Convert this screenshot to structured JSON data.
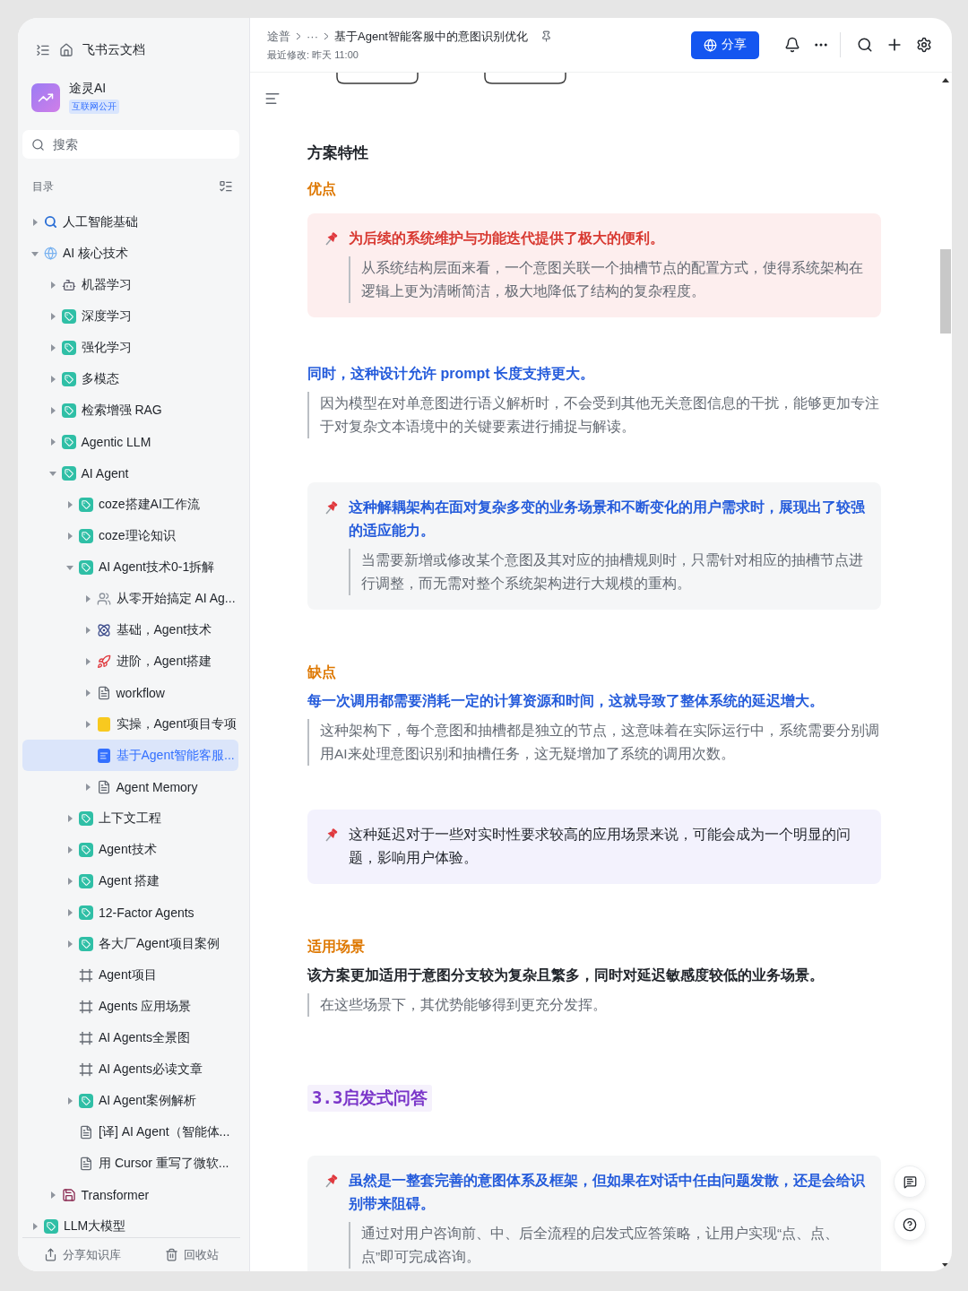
{
  "sidebar": {
    "header": {
      "title": "飞书云文档"
    },
    "workspace": {
      "name": "途灵AI",
      "badge": "互联网公开"
    },
    "search": {
      "placeholder": "搜索"
    },
    "toc_label": "目录",
    "tree": [
      {
        "label": "人工智能基础",
        "expanded": false,
        "selected": false
      },
      {
        "label": "AI 核心技术",
        "expanded": true,
        "selected": false,
        "children": [
          {
            "label": "机器学习",
            "expanded": false,
            "selected": false
          },
          {
            "label": "深度学习",
            "expanded": false,
            "selected": false
          },
          {
            "label": "强化学习",
            "expanded": false,
            "selected": false
          },
          {
            "label": "多模态",
            "expanded": false,
            "selected": false
          },
          {
            "label": "检索增强 RAG",
            "expanded": false,
            "selected": false
          },
          {
            "label": "Agentic LLM",
            "expanded": false,
            "selected": false
          },
          {
            "label": "AI Agent",
            "expanded": true,
            "selected": false,
            "children": [
              {
                "label": "coze搭建AI工作流",
                "expanded": false,
                "selected": false
              },
              {
                "label": "coze理论知识",
                "expanded": false,
                "selected": false
              },
              {
                "label": "AI Agent技术0-1拆解",
                "expanded": true,
                "selected": false,
                "children": [
                  {
                    "label": "从零开始搞定 AI Ag...",
                    "expanded": false,
                    "selected": false
                  },
                  {
                    "label": "基础，Agent技术",
                    "expanded": false,
                    "selected": false
                  },
                  {
                    "label": "进阶，Agent搭建",
                    "expanded": false,
                    "selected": false
                  },
                  {
                    "label": "workflow",
                    "expanded": false,
                    "selected": false
                  },
                  {
                    "label": "实操，Agent项目专项",
                    "expanded": false,
                    "selected": false
                  },
                  {
                    "label": "基于Agent智能客服...",
                    "selected": true
                  },
                  {
                    "label": "Agent Memory",
                    "expanded": false,
                    "selected": false
                  }
                ]
              },
              {
                "label": "上下文工程",
                "expanded": false,
                "selected": false
              },
              {
                "label": "Agent技术",
                "expanded": false,
                "selected": false
              },
              {
                "label": "Agent 搭建",
                "expanded": false,
                "selected": false
              },
              {
                "label": "12-Factor Agents",
                "expanded": false,
                "selected": false
              },
              {
                "label": "各大厂Agent项目案例",
                "expanded": false,
                "selected": false
              },
              {
                "label": "Agent项目",
                "selected": false
              },
              {
                "label": "Agents 应用场景",
                "selected": false
              },
              {
                "label": "AI Agents全景图",
                "selected": false
              },
              {
                "label": "AI Agents必读文章",
                "selected": false
              },
              {
                "label": "AI Agent案例解析",
                "expanded": false,
                "selected": false
              },
              {
                "label": "[译] AI Agent（智能体...",
                "selected": false
              },
              {
                "label": "用 Cursor 重写了微软...",
                "selected": false
              }
            ]
          },
          {
            "label": "Transformer",
            "expanded": false,
            "selected": false
          }
        ]
      },
      {
        "label": "LLM大模型",
        "expanded": false,
        "selected": false
      }
    ],
    "footer": [
      {
        "label": "分享知识库"
      },
      {
        "label": "回收站"
      }
    ]
  },
  "doc_header": {
    "breadcrumb": [
      "途普",
      "···",
      "基于Agent智能客服中的意图识别优化"
    ],
    "modified": "最近修改: 昨天 11:00",
    "share": "分享"
  },
  "content": [
    {
      "kind": "heading",
      "text": "方案特性"
    },
    {
      "kind": "label",
      "text": "优点"
    },
    {
      "kind": "warning-callout",
      "title": "为后续的系统维护与功能迭代提供了极大的便利。",
      "body": "从系统结构层面来看，一个意图关联一个抽槽节点的配置方式，使得系统架构在逻辑上更为清晰简洁，极大地降低了结构的复杂程度。"
    },
    {
      "kind": "lead",
      "title": "同时，这种设计允许 prompt 长度支持更大。",
      "body": "因为模型在对单意图进行语义解析时，不会受到其他无关意图信息的干扰，能够更加专注于对复杂文本语境中的关键要素进行捕捉与解读。"
    },
    {
      "kind": "note-callout",
      "title": "这种解耦架构在面对复杂多变的业务场景和不断变化的用户需求时，展现出了较强的适应能力。",
      "body": "当需要新增或修改某个意图及其对应的抽槽规则时，只需针对相应的抽槽节点进行调整，而无需对整个系统架构进行大规模的重构。"
    },
    {
      "kind": "label",
      "text": "缺点"
    },
    {
      "kind": "lead",
      "title": "每一次调用都需要消耗一定的计算资源和时间，这就导致了整体系统的延迟增大。",
      "body": "这种架构下，每个意图和抽槽都是独立的节点，这意味着在实际运行中，系统需要分别调用AI来处理意图识别和抽槽任务，这无疑增加了系统的调用次数。"
    },
    {
      "kind": "info-callout",
      "title": "这种延迟对于一些对实时性要求较高的应用场景来说，可能会成为一个明显的问题，影响用户体验。"
    },
    {
      "kind": "label",
      "text": "适用场景"
    },
    {
      "kind": "summary",
      "title": "该方案更加适用于意图分支较为复杂且繁多，同时对延迟敏感度较低的业务场景。",
      "body": "在这些场景下，其优势能够得到更充分发挥。"
    },
    {
      "kind": "section",
      "text": "3.3启发式问答"
    },
    {
      "kind": "note-callout",
      "title": "虽然是一整套完善的意图体系及框架，但如果在对话中任由问题发散，还是会给识别带来阻碍。",
      "body": "通过对用户咨询前、中、后全流程的启发式应答策略，让用户实现“点、点、点”即可完成咨询。"
    }
  ]
}
